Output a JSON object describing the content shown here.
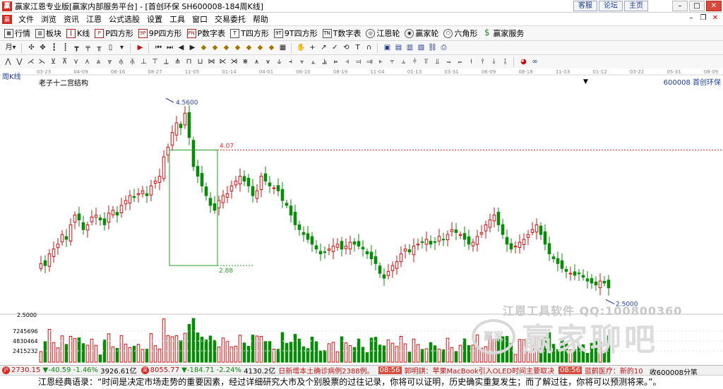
{
  "window": {
    "title": "赢家江恩专业版[赢家内部服务平台] - [首创环保  SH600008-184周K线]",
    "links": [
      "客服",
      "论坛",
      "主页"
    ]
  },
  "menu": [
    "文件",
    "浏览",
    "资讯",
    "江恩",
    "公式选股",
    "设置",
    "工具",
    "窗口",
    "交易委托",
    "帮助"
  ],
  "toolbar1": [
    {
      "label": "行情",
      "icon": "grid-icon"
    },
    {
      "label": "板块",
      "icon": "blocks-icon"
    },
    {
      "label": "K线",
      "icon": "kline-icon"
    },
    {
      "label": "P四方形",
      "icon": "p-square-icon"
    },
    {
      "label": "9P四方形",
      "icon": "9p-square-icon"
    },
    {
      "label": "P数字表",
      "icon": "p-table-icon"
    },
    {
      "label": "T四方形",
      "icon": "t-square-icon"
    },
    {
      "label": "9T四方形",
      "icon": "9t-square-icon"
    },
    {
      "label": "T数字表",
      "icon": "t-table-icon"
    },
    {
      "label": "江恩轮",
      "icon": "gann-wheel-icon"
    },
    {
      "label": "赢家轮",
      "icon": "winner-wheel-icon"
    },
    {
      "label": "六角形",
      "icon": "hexagon-icon"
    },
    {
      "label": "赢家服务",
      "icon": "dollar-icon"
    }
  ],
  "chart": {
    "period_label": "周K线",
    "indicator_name": "老子十二宫结构",
    "stock_label": "600008 首创环保",
    "time_ticks": [
      "03-23",
      "04-09",
      "06-16",
      "08-27",
      "11-05",
      "01-14",
      "04-01",
      "06-10",
      "08-19",
      "11-04",
      "01-13",
      "03-31",
      "06-09",
      "08-18",
      "11-03",
      "01-12",
      "03-22",
      "05-31",
      "08-09"
    ],
    "price_labels": {
      "high": "4.5600",
      "upper": "4.07",
      "lower": "2.88",
      "low": "2.5000",
      "axis_base": "2.5000"
    },
    "volume_ticks": [
      "7245696",
      "4830464",
      "2415232"
    ]
  },
  "chart_data": {
    "type": "candlestick",
    "title": "",
    "xlabel": "",
    "ylabel": "",
    "ylim": [
      2.35,
      4.75
    ],
    "series": [
      {
        "values": [
          2.9,
          2.88,
          3.0,
          3.05,
          3.1,
          3.2,
          3.15,
          3.3,
          3.4,
          3.35,
          3.25,
          3.3,
          3.38,
          3.4,
          3.35,
          3.3,
          3.42,
          3.45,
          3.4,
          3.5,
          3.55,
          3.6,
          3.58,
          3.62,
          3.65,
          3.6,
          3.7,
          3.75,
          3.8,
          4.0,
          4.1,
          4.25,
          4.35,
          4.3,
          4.45,
          4.2,
          3.9,
          3.8,
          3.7,
          3.6,
          3.5,
          3.45,
          3.55,
          3.6,
          3.62,
          3.7,
          3.75,
          3.8,
          3.75,
          3.7,
          3.6,
          3.65,
          3.8,
          3.75,
          3.7,
          3.68,
          3.65,
          3.55,
          3.5,
          3.4,
          3.3,
          3.25,
          3.2,
          3.15,
          3.1,
          3.05,
          3.0,
          3.02,
          3.05,
          3.08,
          3.1,
          3.05,
          3.08,
          3.12,
          3.1,
          3.08,
          3.05,
          3.0,
          2.95,
          2.9,
          2.8,
          2.75,
          2.82,
          2.88,
          2.92,
          3.0,
          3.05,
          3.02,
          3.08,
          3.1,
          3.12,
          3.15,
          3.1,
          3.12,
          3.18,
          3.15,
          3.2,
          3.25,
          3.22,
          3.2,
          3.15,
          3.1,
          3.12,
          3.18,
          3.22,
          3.3,
          3.35,
          3.4,
          3.3,
          3.2,
          3.1,
          3.05,
          3.08,
          3.12,
          3.15,
          3.2,
          3.25,
          3.3,
          3.2,
          3.1,
          3.0,
          2.95,
          2.9,
          2.85,
          2.82,
          2.8,
          2.78,
          2.8,
          2.76,
          2.72,
          2.7,
          2.68,
          2.72,
          2.7,
          2.65
        ]
      }
    ]
  },
  "statusbar": {
    "sh_index": "2730.15",
    "sh_change": "▼-40.59",
    "sh_pct": "-1.46%",
    "sh_amount": "3926.61亿",
    "sz_index": "8055.77",
    "sz_change": "▼-184.71",
    "sz_pct": "-2.24%",
    "sz_amount": "4130.2亿",
    "news1": "日新增本土确诊病例2388例。",
    "time1": "08:56",
    "news2": "郭明錤：苹果MacBook引入OLED时间主要取决",
    "time2": "08:56",
    "news3": "蓝鹤医疗：新的10",
    "right": "收600008分笔"
  },
  "quote": "江恩经典语录：“时间是决定市场走势的重要因素，经过详细研究大市及个别股票的过往记录，你将可以证明，历史确实重复发生；而了解过往，你将可以预测将来。”。",
  "watermark": {
    "text": "江恩工具软件 QQ:100800360",
    "logo_circle": "赢家",
    "logo_text": "赢家聊吧"
  },
  "colors": {
    "up": "#d01010",
    "down": "#0a8a0a",
    "box": "#2aa02a",
    "blue_label": "#1e3fa0",
    "red_line": "#e03030"
  }
}
